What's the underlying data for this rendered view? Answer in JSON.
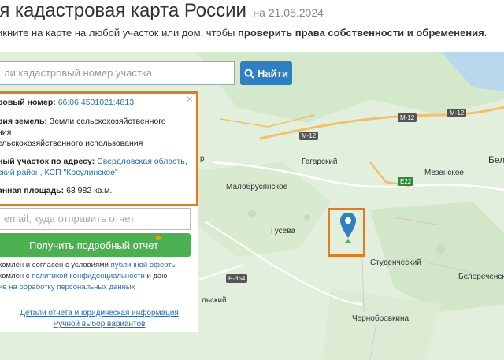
{
  "header": {
    "title": "ая кадастровая карта России",
    "date": "на 21.05.2024",
    "subtitle_prefix": "икните на карте на любой участок или дом, чтобы",
    "subtitle_bold": "проверить права собственности и обременения",
    "subtitle_suffix": "."
  },
  "search": {
    "placeholder": "ли кадастровый номер участка",
    "button_label": "Найти"
  },
  "card": {
    "cadastral_label": "ровый номер:",
    "cadastral_value": "66:06:4501021:4813",
    "category_label": "рия земель:",
    "category_value_1": "Земли сельскохозяйственного",
    "category_value_2": "ния",
    "category_value_3": "ельскохозяйственного использования",
    "address_label": "ный участок по адресу:",
    "address_value_1": "Свердловская область,",
    "address_value_2": "ский район, КСП \"Косулинское\"",
    "area_label": "анная площадь:",
    "area_value": "63 982 кв.м.",
    "close": "×"
  },
  "report": {
    "email_placeholder": "email, куда отправить отчет",
    "button_label": "Получить подробный отчет",
    "legal_1_prefix": "комлен и согласен с условиями",
    "legal_1_link": "публичной оферты",
    "legal_2_prefix": "комлен с",
    "legal_2_link": "политикой конфиденциальности",
    "legal_2_suffix": "и даю",
    "legal_3_link": "ие на обработку персональных данных",
    "link_details": "Детали отчета и юридическая информация",
    "link_manual": "Ручной выбор вариантов"
  },
  "map": {
    "places": {
      "gagarsky": "Гагарский",
      "malobrus": "Малобрусянское",
      "mezensk": "Мезенское",
      "guseva": "Гусева",
      "studench": "Студенческий",
      "beloretch": "Белореченский",
      "chernob": "Чернобровкина",
      "bel": "Бел",
      "p_left": "р",
      "lsky": "льский"
    },
    "roads": {
      "m12a": "М-12",
      "m12b": "М-12",
      "m12c": "М-12",
      "e22": "E22",
      "p354": "Р-354"
    }
  },
  "colors": {
    "accent": "#e07b1f",
    "primary": "#2f7fc1",
    "success": "#4caf50"
  }
}
